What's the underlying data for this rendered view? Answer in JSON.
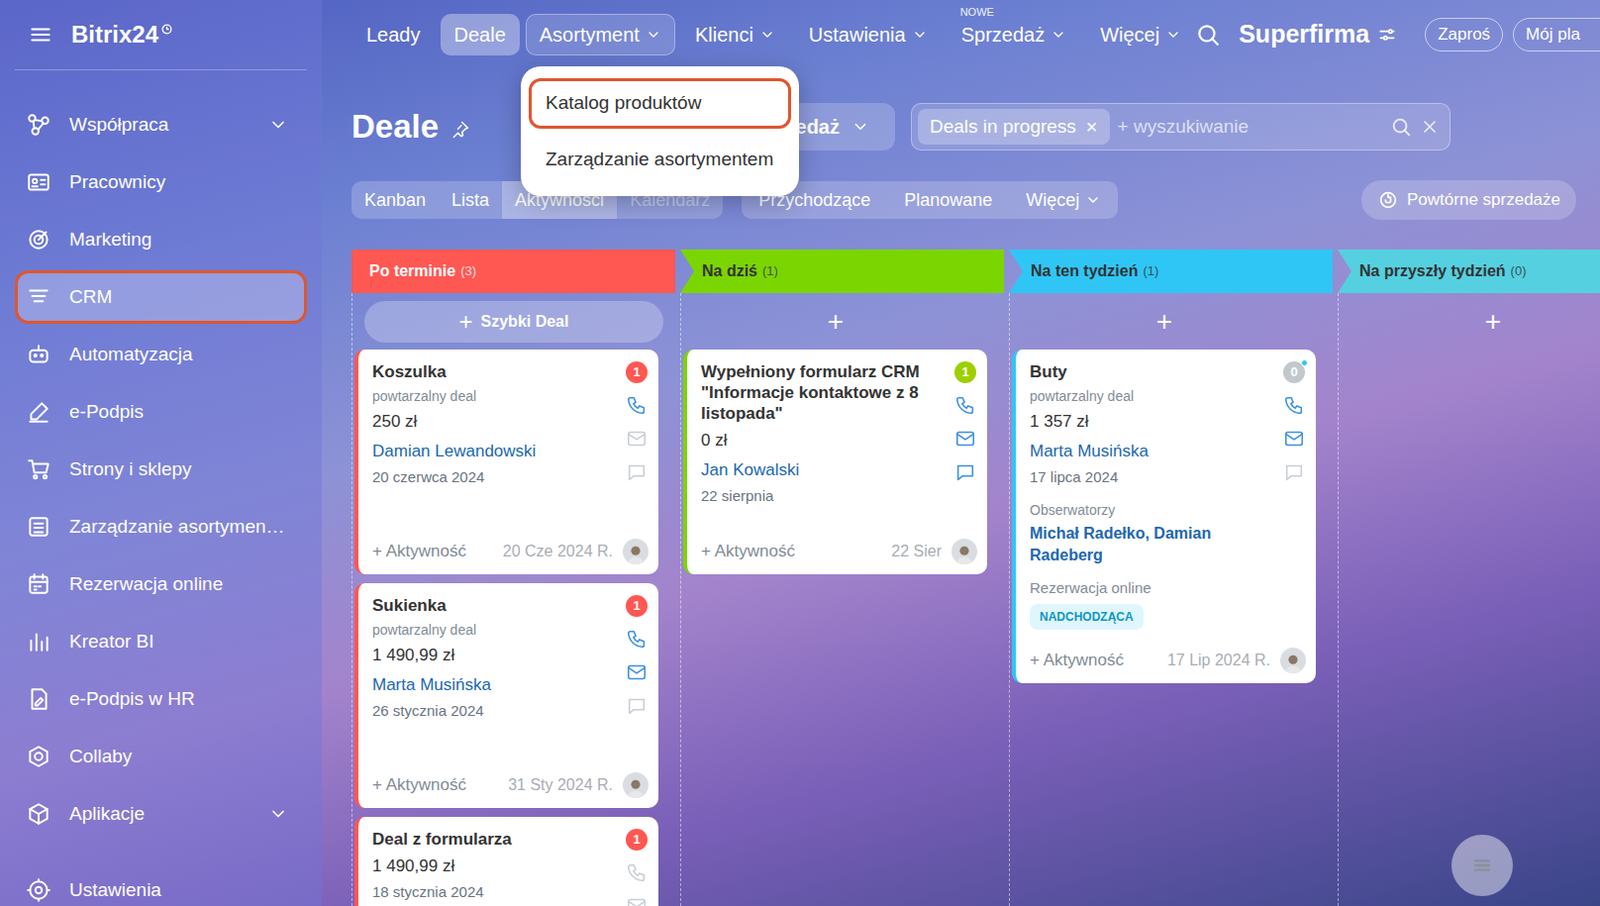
{
  "logo": {
    "text": "Bitrix24"
  },
  "sidebar": {
    "items": [
      {
        "label": "Współpraca",
        "expandable": true,
        "selected": false
      },
      {
        "label": "Pracownicy",
        "expandable": false,
        "selected": false
      },
      {
        "label": "Marketing",
        "expandable": false,
        "selected": false
      },
      {
        "label": "CRM",
        "expandable": false,
        "selected": true
      },
      {
        "label": "Automatyzacja",
        "expandable": false,
        "selected": false
      },
      {
        "label": "e-Podpis",
        "expandable": false,
        "selected": false
      },
      {
        "label": "Strony i sklepy",
        "expandable": false,
        "selected": false
      },
      {
        "label": "Zarządzanie asortymen…",
        "expandable": false,
        "selected": false
      },
      {
        "label": "Rezerwacja online",
        "expandable": false,
        "selected": false
      },
      {
        "label": "Kreator BI",
        "expandable": false,
        "selected": false
      },
      {
        "label": "e-Podpis w HR",
        "expandable": false,
        "selected": false
      },
      {
        "label": "Collaby",
        "expandable": false,
        "selected": false
      },
      {
        "label": "Aplikacje",
        "expandable": true,
        "selected": false
      }
    ],
    "footer": {
      "label": "Ustawienia"
    }
  },
  "topnav": {
    "tabs": [
      {
        "label": "Leady",
        "selected": false,
        "open": false,
        "dropdown": false
      },
      {
        "label": "Deale",
        "selected": true,
        "open": false,
        "dropdown": false
      },
      {
        "label": "Asortyment",
        "selected": false,
        "open": true,
        "dropdown": true
      },
      {
        "label": "Klienci",
        "selected": false,
        "open": false,
        "dropdown": true
      },
      {
        "label": "Ustawienia",
        "selected": false,
        "open": false,
        "dropdown": true
      },
      {
        "label": "Sprzedaż",
        "selected": false,
        "open": false,
        "dropdown": true,
        "badge": "NOWE"
      },
      {
        "label": "Więcej",
        "selected": false,
        "open": false,
        "dropdown": true
      }
    ],
    "company": "Superfirma",
    "buttons": [
      {
        "label": "Zaproś"
      },
      {
        "label": "Mój pla"
      }
    ]
  },
  "menu": {
    "items": [
      {
        "label": "Katalog produktów",
        "highlighted": true
      },
      {
        "label": "Zarządzanie asortymentem",
        "highlighted": false
      }
    ]
  },
  "page": {
    "title": "Deale",
    "category": "edaż",
    "filter": {
      "tags": [
        {
          "label": "Deals in progress",
          "remove": "×"
        }
      ],
      "placeholder": "+ wyszukiwanie"
    }
  },
  "views": {
    "tabs": [
      {
        "label": "Kanban",
        "selected": false,
        "disabled": false
      },
      {
        "label": "Lista",
        "selected": false,
        "disabled": false
      },
      {
        "label": "Aktywności",
        "selected": true,
        "disabled": false
      },
      {
        "label": "Kalendarz",
        "selected": false,
        "disabled": true
      }
    ],
    "filters": [
      {
        "label": "Przychodzące",
        "dropdown": false
      },
      {
        "label": "Planowane",
        "dropdown": false
      },
      {
        "label": "Więcej",
        "dropdown": true
      }
    ],
    "repeat_sales": "Powtórne sprzedaże"
  },
  "columns": [
    {
      "title": "Po terminie",
      "count": "(3)",
      "color": "#ff5752",
      "add": {
        "icon": "+",
        "label": "Szybki Deal"
      },
      "cards": [
        {
          "title": "Koszulka",
          "subtitle": "powtarzalny deal",
          "amount": "250 zł",
          "contact": "Damian Lewandowski",
          "date": "20 czerwca 2024",
          "badge": {
            "count": "1",
            "color": "#ff5752",
            "unread": false
          },
          "channels": [
            {
              "kind": "phone",
              "active": true
            },
            {
              "kind": "mail",
              "active": false
            },
            {
              "kind": "chat",
              "active": false
            }
          ],
          "activity": "+ Aktywność",
          "footer_date": "20 Cze 2024 R."
        },
        {
          "title": "Sukienka",
          "subtitle": "powtarzalny deal",
          "amount": "1 490,99 zł",
          "contact": "Marta Musińska",
          "date": "26 stycznia 2024",
          "badge": {
            "count": "1",
            "color": "#ff5752",
            "unread": false
          },
          "channels": [
            {
              "kind": "phone",
              "active": true
            },
            {
              "kind": "mail",
              "active": true
            },
            {
              "kind": "chat",
              "active": false
            }
          ],
          "activity": "+ Aktywność",
          "footer_date": "31 Sty 2024 R."
        },
        {
          "title": "Deal z formularza",
          "amount": "1 490,99 zł",
          "date": "18 stycznia 2024",
          "badge": {
            "count": "1",
            "color": "#ff5752",
            "unread": false
          },
          "channels": [
            {
              "kind": "phone",
              "active": false
            },
            {
              "kind": "mail",
              "active": false
            }
          ]
        }
      ]
    },
    {
      "title": "Na dziś",
      "count": "(1)",
      "color": "#7bd500",
      "add": {
        "icon": "+"
      },
      "cards": [
        {
          "title": "Wypełniony formularz CRM \"Informacje kontaktowe z 8 listopada\"",
          "amount": "0 zł",
          "contact": "Jan Kowalski",
          "date": "22 sierpnia",
          "badge": {
            "count": "1",
            "color": "#9dcf00",
            "unread": false
          },
          "channels": [
            {
              "kind": "phone",
              "active": true
            },
            {
              "kind": "mail",
              "active": true
            },
            {
              "kind": "chat",
              "active": true
            }
          ],
          "activity": "+ Aktywność",
          "footer_date": "22 Sier"
        }
      ]
    },
    {
      "title": "Na ten tydzień",
      "count": "(1)",
      "color": "#2fc6f6",
      "add": {
        "icon": "+"
      },
      "cards": [
        {
          "title": "Buty",
          "subtitle": "powtarzalny deal",
          "amount": "1 357 zł",
          "contact": "Marta Musińska",
          "date": "17 lipca 2024",
          "observers": {
            "label": "Obserwatorzy",
            "names": "Michał Radełko, Damian Radeberg"
          },
          "booking": {
            "label": "Rezerwacja online",
            "tag": "NADCHODZĄCA"
          },
          "badge": {
            "count": "0",
            "color": "#c3c8cd",
            "unread": true
          },
          "channels": [
            {
              "kind": "phone",
              "active": true
            },
            {
              "kind": "mail",
              "active": true
            },
            {
              "kind": "chat",
              "active": false
            }
          ],
          "activity": "+ Aktywność",
          "footer_date": "17 Lip 2024 R."
        }
      ]
    },
    {
      "title": "Na przyszły tydzień",
      "count": "(0)",
      "color": "#55d0e0",
      "add": {
        "icon": "+"
      },
      "cards": []
    }
  ]
}
